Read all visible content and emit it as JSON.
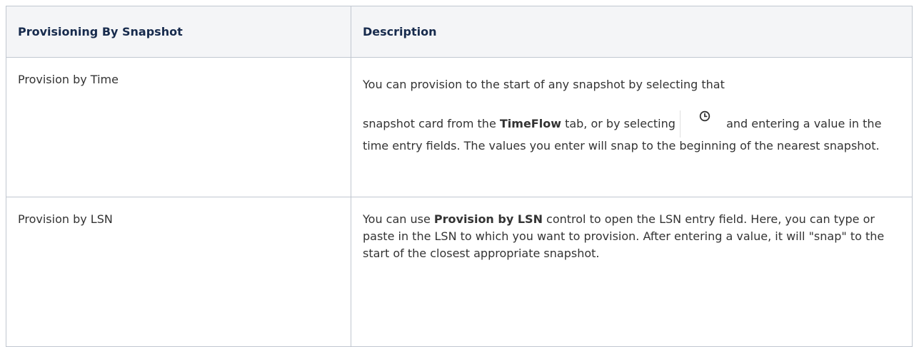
{
  "table": {
    "headers": [
      "Provisioning By Snapshot",
      "Description"
    ],
    "rows": [
      {
        "name": "Provision by Time",
        "description": {
          "line1": "You can provision to the start of any snapshot by selecting that",
          "part2": "snapshot card from the ",
          "bold1": "TimeFlow",
          "part3": " tab, or by selecting ",
          "part4": " and entering a value in the time entry fields. The values you enter will snap to the beginning of the nearest snapshot.",
          "icon": "clock-icon"
        }
      },
      {
        "name": "Provision by LSN",
        "description": {
          "part1": "You can use ",
          "bold1": "Provision by LSN",
          "part2": " control to open the LSN entry field. Here, you can type or paste in the LSN to which you want to provision. After entering a value, it will \"snap\" to the start of the closest appropriate snapshot."
        }
      }
    ]
  }
}
